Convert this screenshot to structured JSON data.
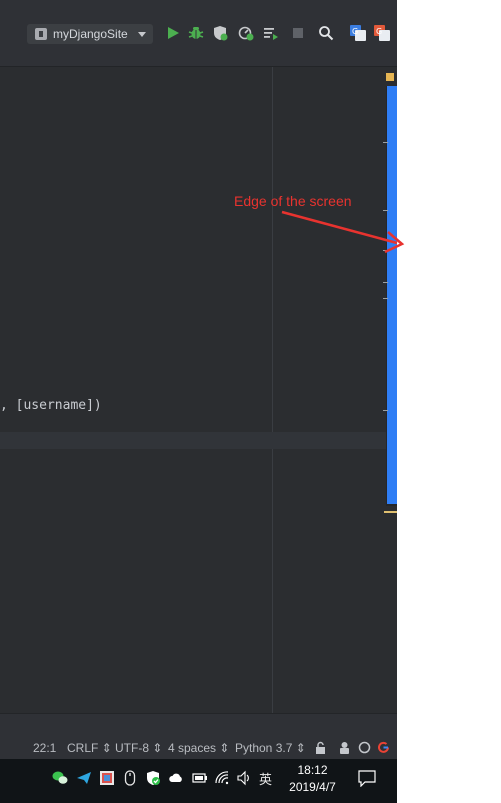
{
  "toolbar": {
    "run_config_label": "myDjangoSite"
  },
  "editor": {
    "code_fragment": ", [username])"
  },
  "statusbar": {
    "position": "22:1",
    "line_separator": "CRLF",
    "encoding": "UTF-8",
    "indent": "4 spaces",
    "interpreter": "Python 3.7"
  },
  "taskbar": {
    "ime_label": "英",
    "time": "18:12",
    "date": "2019/4/7"
  },
  "annotation": {
    "text": "Edge of the screen",
    "color": "#e8332f"
  },
  "colors": {
    "editor_bg": "#2b2d30",
    "scrollbar_thumb": "#2f7ef5",
    "run_green": "#4caf50",
    "taskbar_bg": "#101417"
  },
  "icons": {
    "run": "play-icon",
    "debug": "bug-icon",
    "coverage": "coverage-shield-icon",
    "profile": "profile-icon",
    "concurrency": "concurrency-icon",
    "stop": "stop-icon",
    "search": "search-icon",
    "translate_1": "translate-icon",
    "translate_2": "translate-alt-icon"
  }
}
